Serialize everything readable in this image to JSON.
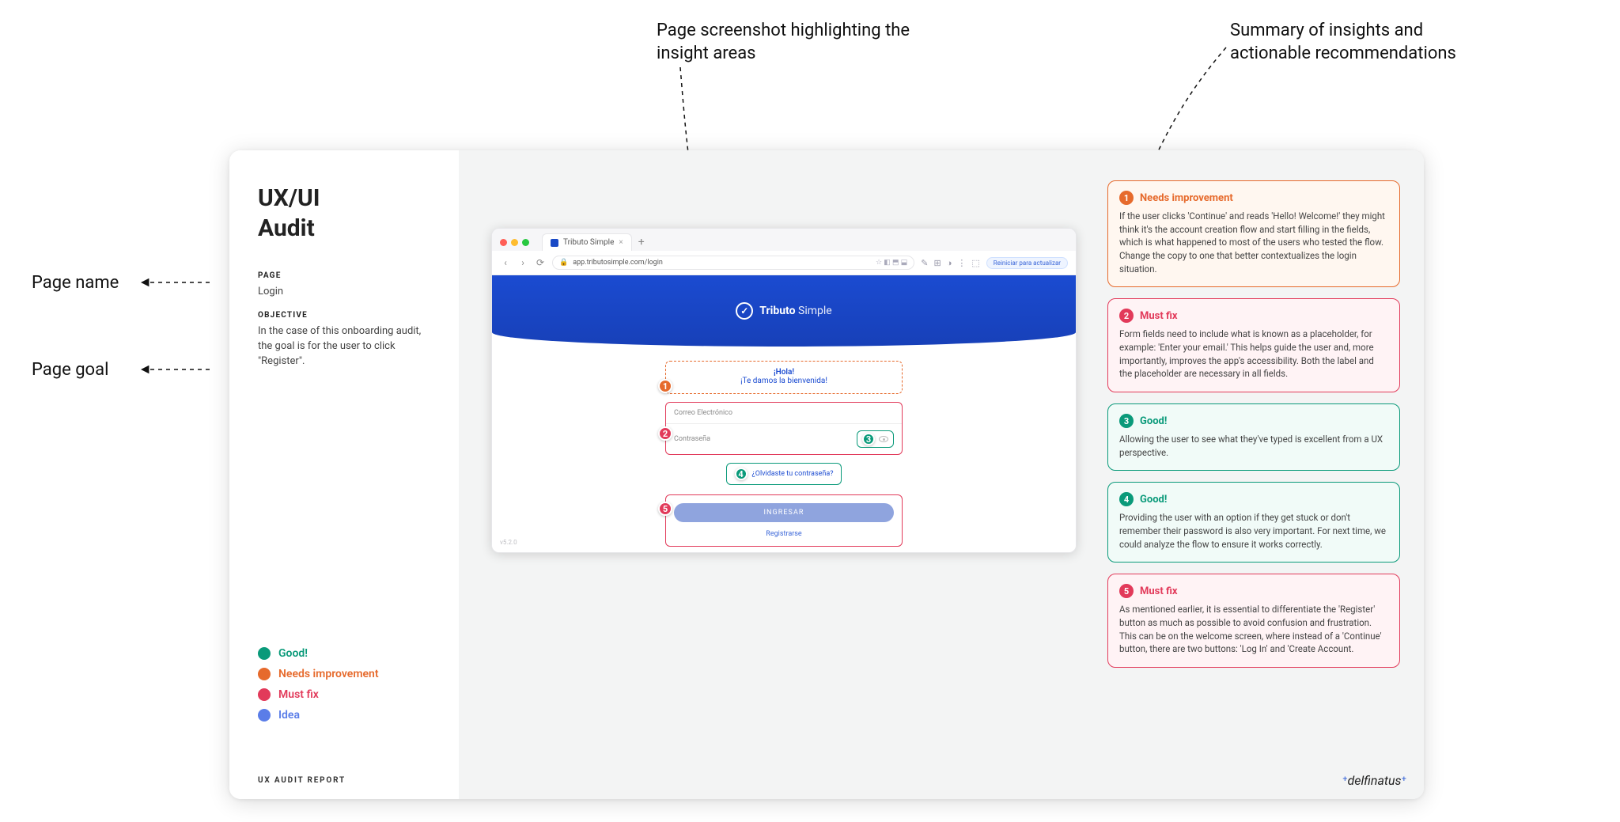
{
  "annotations": {
    "page_name": "Page name",
    "page_goal": "Page goal",
    "screenshot": "Page screenshot highlighting the insight areas",
    "insights": "Summary of insights and actionable recommendations"
  },
  "sidebar": {
    "title_line1": "UX/UI",
    "title_line2": "Audit",
    "page_label": "PAGE",
    "page_value": "Login",
    "objective_label": "OBJECTIVE",
    "objective_value": "In the case of this onboarding audit, the goal is for the user to click \"Register\".",
    "footer": "UX AUDIT REPORT"
  },
  "legend": {
    "good": "Good!",
    "needs_improvement": "Needs improvement",
    "must_fix": "Must fix",
    "idea": "Idea"
  },
  "colors": {
    "good": "#0a9a7a",
    "needs_improvement": "#e66a2c",
    "must_fix": "#e23a5a",
    "idea": "#5a7de8"
  },
  "browser": {
    "tab_title": "Tributo Simple",
    "url_host": "app.tributosimple.com/login",
    "refresh_pill": "Reiniciar para actualizar",
    "hero_brand1": "Tributo",
    "hero_brand2": "Simple",
    "welcome_line1": "¡Hola!",
    "welcome_line2": "¡Te damos la bienvenida!",
    "field_email": "Correo Electrónico",
    "field_password": "Contraseña",
    "forgot": "¿Olvidaste tu contraseña?",
    "cta": "INGRESAR",
    "register": "Registrarse",
    "version": "v5.2.0"
  },
  "markers": {
    "m1": "1",
    "m2": "2",
    "m3": "3",
    "m4": "4",
    "m5": "5"
  },
  "insights": [
    {
      "num": "1",
      "tone": "orange",
      "title": "Needs improvement",
      "body": "If the user clicks 'Continue' and reads 'Hello! Welcome!' they might think it's the account creation flow and start filling in the fields, which is what happened to most of the users who tested the flow. Change the copy to one that better contextualizes the login situation."
    },
    {
      "num": "2",
      "tone": "red",
      "title": "Must fix",
      "body": "Form fields need to include what is known as a placeholder, for example: 'Enter your email.' This helps guide the user and, more importantly, improves the app's accessibility. Both the label and the placeholder are necessary in all fields."
    },
    {
      "num": "3",
      "tone": "green",
      "title": "Good!",
      "body": "Allowing the user to see what they've typed is excellent from a UX perspective."
    },
    {
      "num": "4",
      "tone": "green",
      "title": "Good!",
      "body": "Providing the user with an option if they get stuck or don't remember their password is also very important. For next time, we could analyze the flow to ensure it works correctly."
    },
    {
      "num": "5",
      "tone": "red",
      "title": "Must fix",
      "body": "As mentioned earlier, it is essential to differentiate the 'Register' button as much as possible to avoid confusion and frustration. This can be on the welcome screen, where instead of a 'Continue' button, there are two buttons: 'Log In' and 'Create Account."
    }
  ],
  "brand": "delfinatus"
}
